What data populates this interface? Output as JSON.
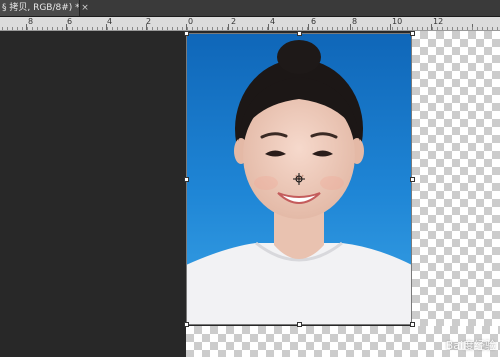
{
  "document": {
    "tab_title": "§ 拷贝, RGB/8#) *",
    "close_glyph": "×"
  },
  "ruler": {
    "labels": [
      "8",
      "6",
      "4",
      "2",
      "0",
      "2",
      "4",
      "6",
      "8",
      "10",
      "12"
    ]
  },
  "canvas": {
    "background_color": "#282828",
    "photo_background_top": "#0f66b8",
    "photo_background_bottom": "#3aa2e6"
  },
  "watermark": {
    "text": "Bai度经验"
  },
  "icons": [
    "close-icon",
    "move-cursor-icon"
  ]
}
